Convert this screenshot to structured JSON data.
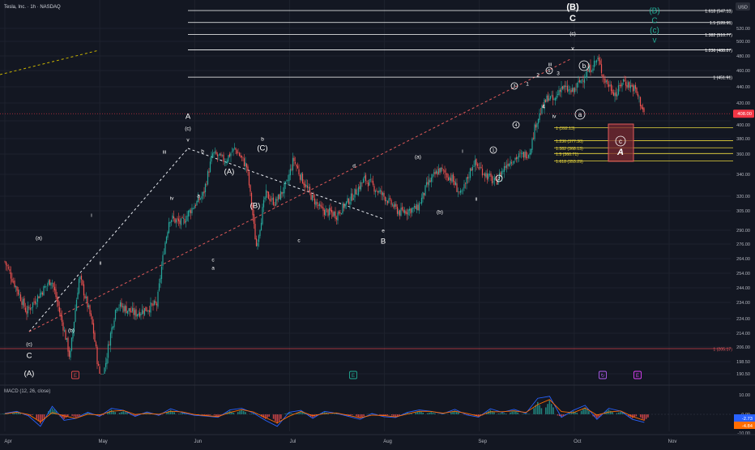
{
  "header": {
    "symbol_line": "Tesla, Inc. · 1h · NASDAQ",
    "currency_button": "USD"
  },
  "colors": {
    "background": "#131722",
    "up": "#26a69a",
    "down": "#ef5350",
    "text": "#d1d4dc",
    "axis_text": "#b2b5be",
    "fib_white": "#ffffff",
    "fib_yellow": "#e8d63c",
    "target_box": "#e25a5a",
    "macd_line": "#2962ff",
    "signal_line": "#ff6d00",
    "teal_label": "#22ab94",
    "price_badge": "#f23645"
  },
  "chart_data": {
    "type": "candlestick",
    "price_axis": {
      "ticks": [
        "520.00",
        "500.00",
        "480.00",
        "460.00",
        "440.00",
        "420.00",
        "400.00",
        "380.00",
        "360.00",
        "340.00",
        "320.00",
        "305.00",
        "290.00",
        "276.00",
        "264.00",
        "254.00",
        "244.00",
        "234.00",
        "224.00",
        "214.00",
        "206.00",
        "198.50",
        "190.50"
      ],
      "last_price": "408.00"
    },
    "time_axis": {
      "labels": [
        "Apr",
        "May",
        "Jun",
        "Jul",
        "Aug",
        "Sep",
        "Oct",
        "Nov"
      ]
    },
    "price_path": [
      [
        "2024-04-01",
        262
      ],
      [
        "2024-04-08",
        228
      ],
      [
        "2024-04-16",
        250
      ],
      [
        "2024-04-22",
        200
      ],
      [
        "2024-04-25",
        252
      ],
      [
        "2024-04-29",
        222
      ],
      [
        "2024-05-02",
        183
      ],
      [
        "2024-05-07",
        233
      ],
      [
        "2024-05-13",
        227
      ],
      [
        "2024-05-20",
        233
      ],
      [
        "2024-05-24",
        300
      ],
      [
        "2024-05-28",
        295
      ],
      [
        "2024-06-04",
        322
      ],
      [
        "2024-06-07",
        361
      ],
      [
        "2024-06-11",
        353
      ],
      [
        "2024-06-14",
        367
      ],
      [
        "2024-06-18",
        347
      ],
      [
        "2024-06-21",
        274
      ],
      [
        "2024-06-24",
        322
      ],
      [
        "2024-06-27",
        313
      ],
      [
        "2024-07-01",
        332
      ],
      [
        "2024-07-03",
        355
      ],
      [
        "2024-07-05",
        340
      ],
      [
        "2024-07-09",
        318
      ],
      [
        "2024-07-12",
        306
      ],
      [
        "2024-07-17",
        302
      ],
      [
        "2024-07-22",
        320
      ],
      [
        "2024-07-26",
        336
      ],
      [
        "2024-08-01",
        320
      ],
      [
        "2024-08-06",
        304
      ],
      [
        "2024-08-12",
        308
      ],
      [
        "2024-08-15",
        330
      ],
      [
        "2024-08-19",
        345
      ],
      [
        "2024-08-23",
        336
      ],
      [
        "2024-08-26",
        320
      ],
      [
        "2024-08-30",
        352
      ],
      [
        "2024-09-04",
        337
      ],
      [
        "2024-09-06",
        332
      ],
      [
        "2024-09-10",
        352
      ],
      [
        "2024-09-13",
        357
      ],
      [
        "2024-09-17",
        362
      ],
      [
        "2024-09-19",
        397
      ],
      [
        "2024-09-23",
        428
      ],
      [
        "2024-09-25",
        422
      ],
      [
        "2024-09-27",
        440
      ],
      [
        "2024-10-01",
        433
      ],
      [
        "2024-10-03",
        445
      ],
      [
        "2024-10-07",
        465
      ],
      [
        "2024-10-09",
        476
      ],
      [
        "2024-10-11",
        450
      ],
      [
        "2024-10-15",
        430
      ],
      [
        "2024-10-17",
        448
      ],
      [
        "2024-10-21",
        437
      ],
      [
        "2024-10-23",
        418
      ],
      [
        "2024-10-24",
        408
      ]
    ],
    "price_levels": [
      {
        "ratio": "1.618",
        "value": "547.13",
        "label": "1.618 (547.13)",
        "color": "white",
        "span": "wide"
      },
      {
        "ratio": "1.5",
        "value": "528.95",
        "label": "1.5 (528.95)",
        "color": "white",
        "span": "wide"
      },
      {
        "ratio": "1.382",
        "value": "510.77",
        "label": "1.382 (510.77)",
        "color": "white",
        "span": "wide"
      },
      {
        "ratio": "1.236",
        "value": "488.27",
        "label": "1.236 (488.27)",
        "color": "white",
        "span": "wide"
      },
      {
        "ratio": "1",
        "value": "451.91",
        "label": "1 (451.91)",
        "color": "white",
        "span": "wide"
      },
      {
        "ratio": "1",
        "value": "392.13",
        "label": "1 (392.13)",
        "color": "yellow",
        "span": "short"
      },
      {
        "ratio": "1.236",
        "value": "377.30",
        "label": "1.236 (377.30)",
        "color": "yellow",
        "span": "short"
      },
      {
        "ratio": "1.382",
        "value": "368.13",
        "label": "1.382 (368.13)",
        "color": "yellow",
        "span": "short"
      },
      {
        "ratio": "1.5",
        "value": "360.71",
        "label": "1.5 (360.71)",
        "color": "yellow",
        "span": "short"
      },
      {
        "ratio": "1.618",
        "value": "353.29",
        "label": "1.618 (353.29)",
        "color": "yellow",
        "span": "short"
      },
      {
        "ratio": "1",
        "value": "205.17",
        "label": "1 (205.17)",
        "color": "red",
        "span": "full"
      }
    ],
    "wave_labels": [
      {
        "text": "(B)",
        "style": "large"
      },
      {
        "text": "C",
        "style": "large"
      },
      {
        "text": "(c)"
      },
      {
        "text": "v"
      },
      {
        "text": "(B)",
        "style": "teal"
      },
      {
        "text": "C",
        "style": "teal"
      },
      {
        "text": "(c)",
        "style": "teal"
      },
      {
        "text": "v",
        "style": "teal"
      },
      {
        "text": "iii"
      },
      {
        "text": "5",
        "style": "circled"
      },
      {
        "text": "b",
        "style": "circled"
      },
      {
        "text": "3",
        "style": "circled"
      },
      {
        "text": "1"
      },
      {
        "text": "2"
      },
      {
        "text": "3"
      },
      {
        "text": "4"
      },
      {
        "text": "iv"
      },
      {
        "text": "a",
        "style": "circled"
      },
      {
        "text": "4",
        "style": "circled"
      },
      {
        "text": "1",
        "style": "circled"
      },
      {
        "text": "2",
        "style": "circled"
      },
      {
        "text": "c",
        "style": "circled"
      },
      {
        "text": "A",
        "style": "italic"
      },
      {
        "text": "A"
      },
      {
        "text": "(c)"
      },
      {
        "text": "v"
      },
      {
        "text": "b"
      },
      {
        "text": "iii"
      },
      {
        "text": "iv"
      },
      {
        "text": "a"
      },
      {
        "text": "(A)"
      },
      {
        "text": "(B)"
      },
      {
        "text": "b"
      },
      {
        "text": "(C)"
      },
      {
        "text": "c"
      },
      {
        "text": "a"
      },
      {
        "text": "d"
      },
      {
        "text": "c"
      },
      {
        "text": "e"
      },
      {
        "text": "B"
      },
      {
        "text": "(a)"
      },
      {
        "text": "i"
      },
      {
        "text": "(b)"
      },
      {
        "text": "ii"
      },
      {
        "text": "i"
      },
      {
        "text": "ii"
      },
      {
        "text": "(a)"
      },
      {
        "text": "(b)"
      },
      {
        "text": "(c)"
      },
      {
        "text": "C"
      },
      {
        "text": "(A)"
      }
    ],
    "event_markers": [
      {
        "glyph": "E",
        "color": "red"
      },
      {
        "glyph": "E",
        "color": "teal"
      },
      {
        "glyph": "↻",
        "color": "purple"
      },
      {
        "glyph": "E",
        "color": "magenta"
      }
    ]
  },
  "macd": {
    "title": "MACD (12, 26, close)",
    "ticks": [
      "10.00",
      "0.00",
      "-10.00"
    ],
    "values": [
      "-2.73",
      "-4.84"
    ],
    "series": [
      0.5,
      1.5,
      -0.8,
      -6,
      4,
      -3,
      -2,
      1,
      -1,
      3,
      2,
      -1,
      1.2,
      -0.5,
      2.8,
      0.8,
      -0.5,
      -0.9,
      -1.5,
      2.2,
      3,
      0.6,
      -3,
      -6,
      1,
      2,
      -2,
      1.5,
      0.5,
      -1,
      -2.5,
      0.4,
      -1.2,
      -1.6,
      1,
      2.2,
      1.5,
      0.3,
      2.5,
      -0.3,
      -1.4,
      2.8,
      1,
      2.5,
      0.5,
      8,
      9,
      -1.5,
      2,
      4.5,
      -2.5,
      3,
      1.6,
      -2.5,
      -4
    ]
  }
}
